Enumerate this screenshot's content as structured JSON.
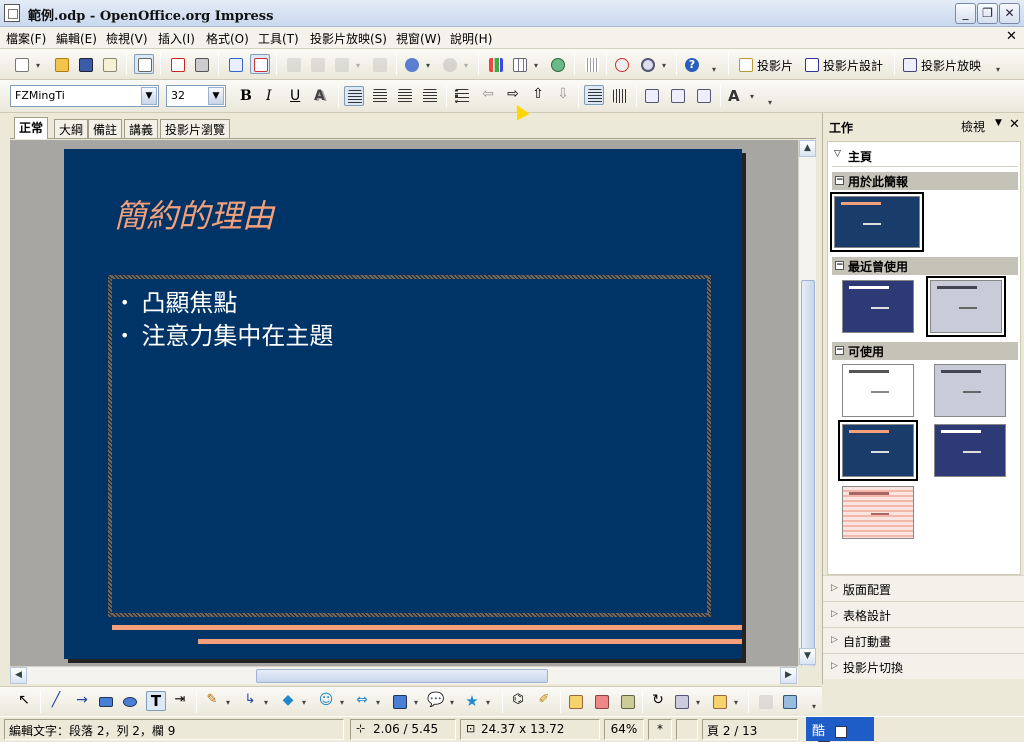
{
  "window": {
    "title": "範例.odp - OpenOffice.org Impress",
    "minimize": "_",
    "restore": "❐",
    "close": "✕"
  },
  "menu": [
    "檔案(F)",
    "編輯(E)",
    "檢視(V)",
    "插入(I)",
    "格式(O)",
    "工具(T)",
    "投影片放映(S)",
    "視窗(W)",
    "說明(H)"
  ],
  "menu_close": "✕",
  "toolbar": {
    "slide_label": "投影片",
    "slide_design_label": "投影片設計",
    "slideshow_label": "投影片放映"
  },
  "format": {
    "font_name": "FZMingTi",
    "font_size": "32",
    "bold": "B",
    "italic": "I",
    "underline": "U",
    "shadow": "A",
    "font_color": "A"
  },
  "view_tabs": [
    "正常",
    "大綱",
    "備註",
    "講義",
    "投影片瀏覽"
  ],
  "slide": {
    "title": "簡約的理由",
    "bullets": [
      "凸顯焦點",
      "注意力集中在主題"
    ]
  },
  "taskpane": {
    "title": "工作",
    "view_label": "檢視",
    "close": "✕",
    "main_label": "主頁",
    "sections": [
      "用於此簡報",
      "最近曾使用",
      "可使用"
    ],
    "collapsed": [
      "版面配置",
      "表格設計",
      "自訂動畫",
      "投影片切換"
    ]
  },
  "statusbar": {
    "edit_info": "編輯文字：段落 2，列 2，欄 9",
    "position": "2.06 / 5.45",
    "size": "24.37 x 13.72",
    "zoom": "64%",
    "modified": "*",
    "page": "頁 2 / 13",
    "ime": "酷"
  },
  "colors": {
    "slide_bg": "#003366",
    "slide_title": "#f4a07a",
    "accent_lines": "#f4a07a"
  }
}
